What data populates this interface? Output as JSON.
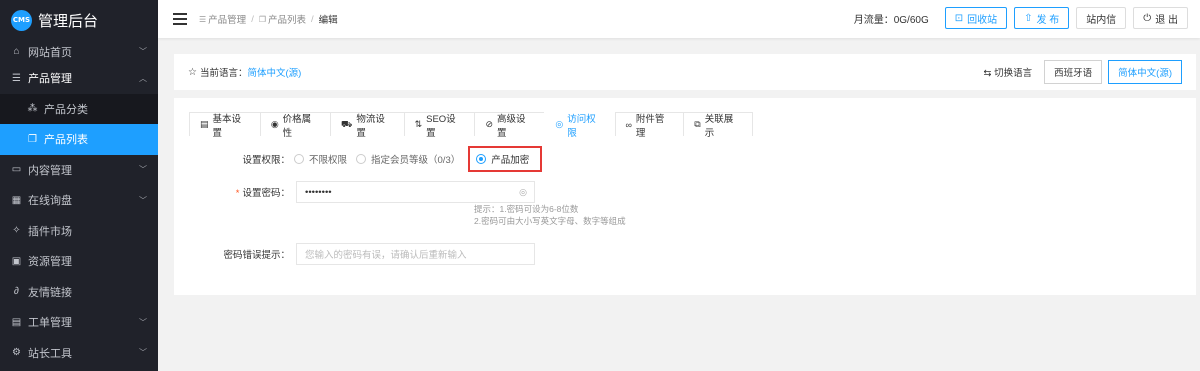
{
  "sidebar": {
    "logo_badge": "CMS",
    "logo_text": "管理后台",
    "items": [
      {
        "label": "网站首页",
        "icon": "home-icon"
      },
      {
        "label": "产品管理",
        "icon": "list-icon"
      },
      {
        "label": "产品分类",
        "icon": "category-icon"
      },
      {
        "label": "产品列表",
        "icon": "product-list-icon"
      },
      {
        "label": "内容管理",
        "icon": "content-icon"
      },
      {
        "label": "在线询盘",
        "icon": "inquiry-icon"
      },
      {
        "label": "插件市场",
        "icon": "plugin-icon"
      },
      {
        "label": "资源管理",
        "icon": "resource-icon"
      },
      {
        "label": "友情链接",
        "icon": "link-icon"
      },
      {
        "label": "工单管理",
        "icon": "ticket-icon"
      },
      {
        "label": "站长工具",
        "icon": "tools-icon"
      }
    ]
  },
  "topbar": {
    "breadcrumb": [
      "产品管理",
      "产品列表",
      "编辑"
    ],
    "traffic": "月流量：0G/60G",
    "recycle_label": "回收站",
    "publish_label": "发 布",
    "inbox_label": "站内信",
    "logout_label": "退 出"
  },
  "langbar": {
    "current_label": "当前语言：",
    "current_value": "简体中文(源)",
    "switch_label": "切换语言",
    "options": [
      "西班牙语",
      "简体中文(源)"
    ]
  },
  "tabs": [
    {
      "label": "基本设置",
      "icon": "doc-icon"
    },
    {
      "label": "价格属性",
      "icon": "price-icon"
    },
    {
      "label": "物流设置",
      "icon": "truck-icon"
    },
    {
      "label": "SEO设置",
      "icon": "seo-icon"
    },
    {
      "label": "高级设置",
      "icon": "advanced-icon"
    },
    {
      "label": "访问权限",
      "icon": "eye-icon"
    },
    {
      "label": "附件管理",
      "icon": "attachment-icon"
    },
    {
      "label": "关联展示",
      "icon": "related-icon"
    }
  ],
  "form": {
    "permission_label": "设置权限：",
    "permission_options": [
      "不限权限",
      "指定会员等级（0/3）",
      "产品加密"
    ],
    "password_label": "设置密码：",
    "password_value": "••••••••",
    "password_hint_1": "提示：1.密码可设为6-8位数",
    "password_hint_2": "2.密码可由大小写英文字母、数字等组成",
    "error_label": "密码错误提示：",
    "error_placeholder": "您输入的密码有误，请确认后重新输入"
  },
  "colors": {
    "accent": "#1e9fff",
    "sidebar_bg": "#20222a",
    "highlight_box": "#e53935"
  }
}
